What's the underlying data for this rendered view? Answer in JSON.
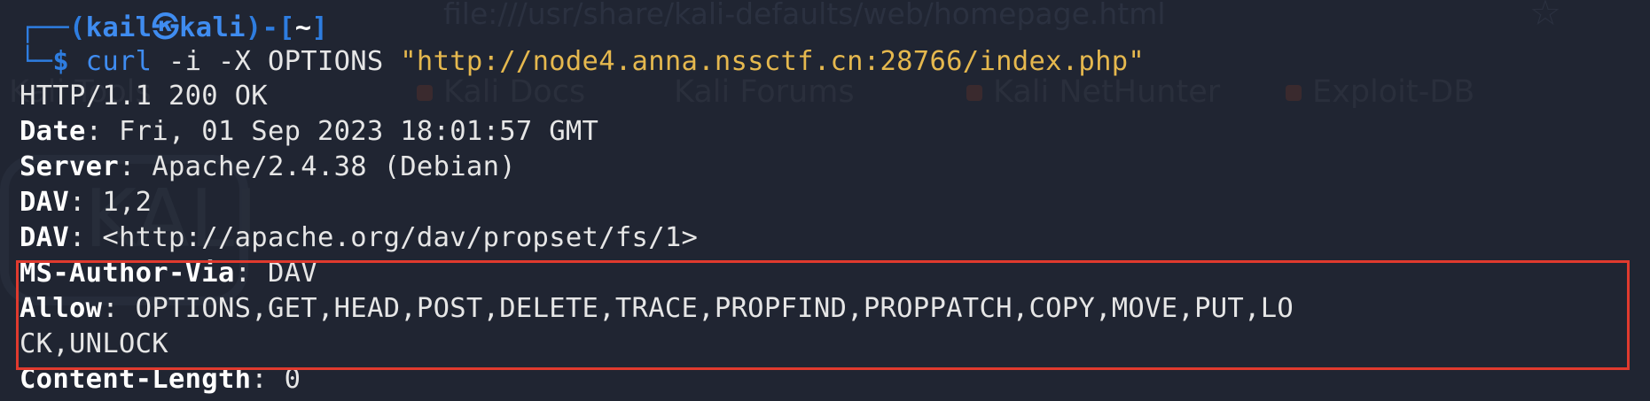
{
  "background_ghost": {
    "url": "file:///usr/share/kali-defaults/web/homepage.html",
    "star": "☆",
    "bookmarks": [
      "Kali Tools",
      "Kali Docs",
      "Kali Forums",
      "Kali NetHunter",
      "Exploit-DB"
    ],
    "logo_text": "KALI"
  },
  "prompt": {
    "frame_top": "┌──(",
    "user": "kail",
    "at_symbol": "㉿",
    "host": "kali",
    "mid": ")-[",
    "dir": "~",
    "end": "]",
    "frame_bottom": "└─$ ",
    "command": "curl",
    "args": " -i -X OPTIONS ",
    "url": "\"http://node4.anna.nssctf.cn:28766/index.php\""
  },
  "output": {
    "status": "HTTP/1.1 200 OK",
    "headers": [
      {
        "key": "Date",
        "value": " Fri, 01 Sep 2023 18:01:57 GMT"
      },
      {
        "key": "Server",
        "value": " Apache/2.4.38 (Debian)"
      },
      {
        "key": "DAV",
        "value": " 1,2"
      },
      {
        "key": "DAV",
        "value": " <http://apache.org/dav/propset/fs/1>"
      },
      {
        "key": "MS-Author-Via",
        "value": " DAV"
      },
      {
        "key": "Allow",
        "value": " OPTIONS,GET,HEAD,POST,DELETE,TRACE,PROPFIND,PROPPATCH,COPY,MOVE,PUT,LO"
      },
      {
        "key": "Content-Length",
        "value": " 0"
      }
    ],
    "allow_wrap": "CK,UNLOCK"
  },
  "colors": {
    "background": "#202532",
    "prompt_blue": "#3f8cf0",
    "string_yellow": "#e5b84e",
    "highlight_red": "#e03a2e"
  }
}
